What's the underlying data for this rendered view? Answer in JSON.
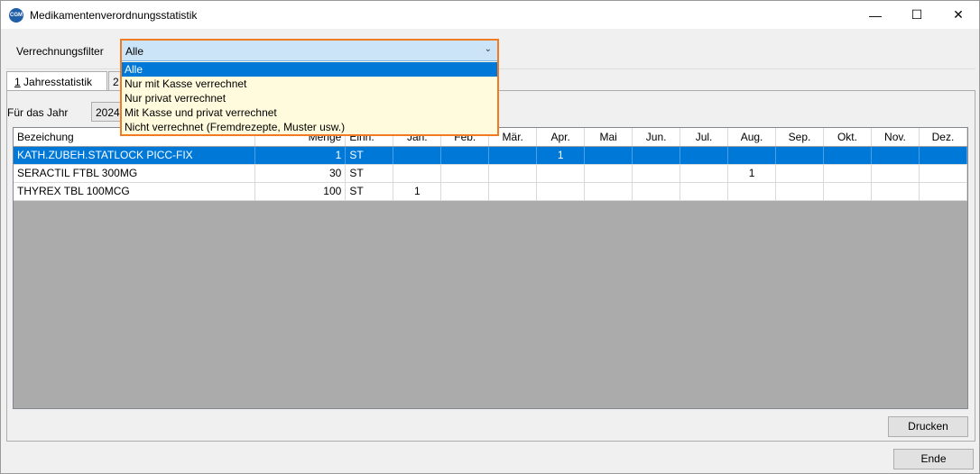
{
  "window": {
    "title": "Medikamentenverordnungsstatistik",
    "icon": "app-icon",
    "icon_text": "CGM",
    "minimize": "—",
    "maximize": "☐",
    "close": "✕"
  },
  "filter": {
    "label": "Verrechnungsfilter",
    "selected": "Alle",
    "arrow": "⌄",
    "options": [
      "Alle",
      "Nur mit Kasse verrechnet",
      "Nur privat verrechnet",
      "Mit Kasse und privat verrechnet",
      "Nicht verrechnet (Fremdrezepte, Muster usw.)"
    ]
  },
  "tabs": {
    "tab1_underline": "1",
    "tab1_rest": " Jahresstatistik",
    "tab2": "2"
  },
  "year": {
    "label": "Für das Jahr",
    "value": "2024"
  },
  "table": {
    "headers": [
      "Bezeichung",
      "Menge",
      "Einh.",
      "Jän.",
      "Feb.",
      "Mär.",
      "Apr.",
      "Mai",
      "Jun.",
      "Jul.",
      "Aug.",
      "Sep.",
      "Okt.",
      "Nov.",
      "Dez."
    ],
    "rows": [
      {
        "name": "KATH.ZUBEH.STATLOCK PICC-FIX",
        "menge": "1",
        "einh": "ST",
        "months": [
          "",
          "",
          "",
          "1",
          "",
          "",
          "",
          "",
          "",
          "",
          "",
          ""
        ],
        "selected": true
      },
      {
        "name": "SERACTIL FTBL 300MG",
        "menge": "30",
        "einh": "ST",
        "months": [
          "",
          "",
          "",
          "",
          "",
          "",
          "",
          "1",
          "",
          "",
          "",
          ""
        ],
        "selected": false
      },
      {
        "name": "THYREX TBL 100MCG",
        "menge": "100",
        "einh": "ST",
        "months": [
          "1",
          "",
          "",
          "",
          "",
          "",
          "",
          "",
          "",
          "",
          "",
          ""
        ],
        "selected": false
      }
    ]
  },
  "buttons": {
    "drucken": "Drucken",
    "ende": "Ende"
  },
  "colors": {
    "accent": "#0078d7",
    "highlight_border": "#f07b22",
    "dropdown_bg": "#fffbdc"
  }
}
